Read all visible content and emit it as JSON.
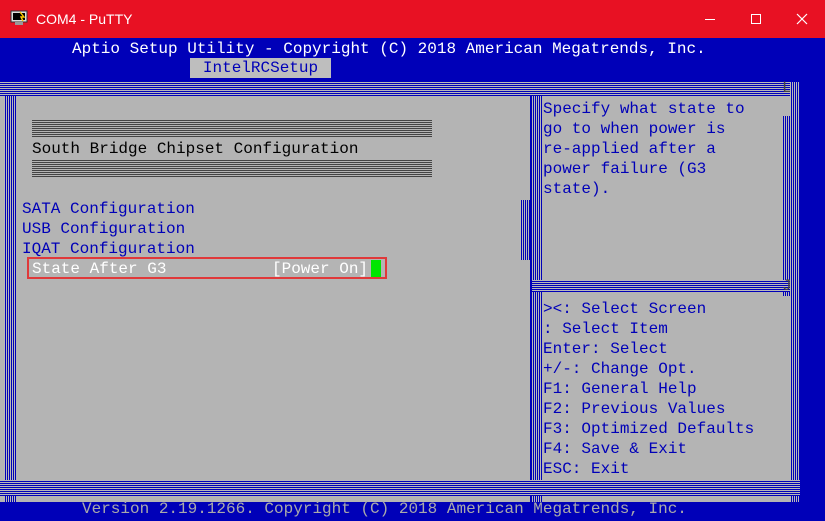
{
  "window": {
    "title": "COM4 - PuTTY",
    "colors": {
      "titlebar": "#e81123",
      "terminal_bg": "#0000b8",
      "panel_bg": "#b4b4b4",
      "highlight": "#e0393a",
      "cursor": "#00e600"
    }
  },
  "bios": {
    "header": "Aptio Setup Utility - Copyright (C) 2018 American Megatrends, Inc.",
    "active_tab": "IntelRCSetup",
    "section_title": "South Bridge Chipset Configuration",
    "menu_items": [
      "SATA Configuration",
      "USB Configuration",
      "IQAT Configuration"
    ],
    "selected_item": {
      "label": "State After G3",
      "value": "[Power On]"
    },
    "help_lines": [
      "Specify what state to",
      "go to when power is",
      "re-applied after a",
      "power failure (G3",
      "state)."
    ],
    "key_help": [
      "><: Select Screen",
      ": Select Item",
      "Enter: Select",
      "+/-: Change Opt.",
      "F1: General Help",
      "F2: Previous Values",
      "F3: Optimized Defaults",
      "F4: Save & Exit",
      "ESC: Exit"
    ],
    "footer": "Version 2.19.1266. Copyright (C) 2018 American Megatrends, Inc."
  }
}
